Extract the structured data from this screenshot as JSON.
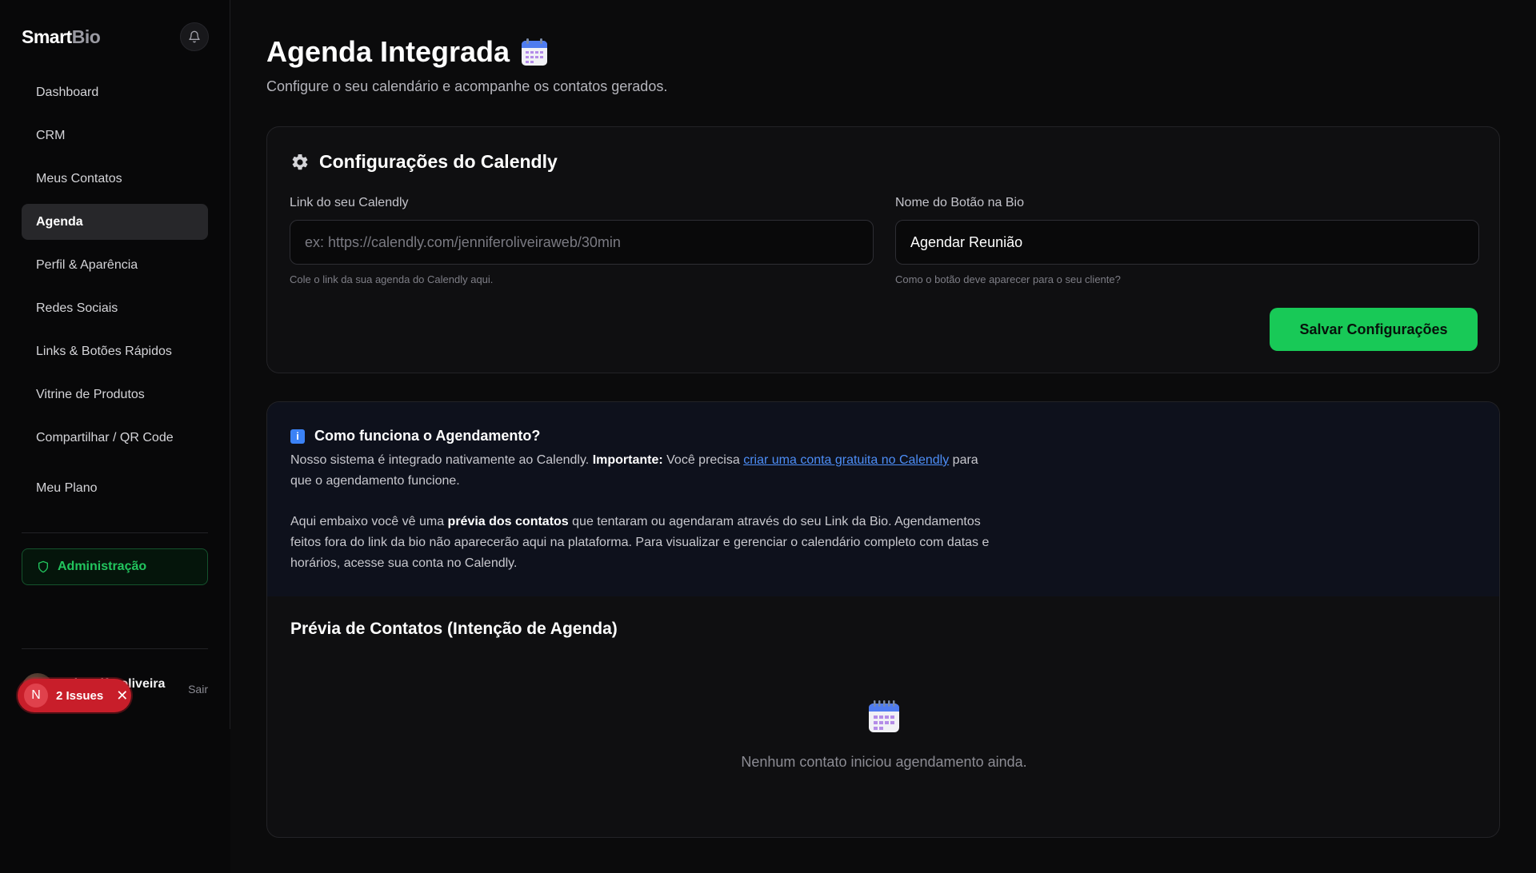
{
  "brand": {
    "name_primary": "Smart",
    "name_secondary": "Bio"
  },
  "sidebar": {
    "items": [
      {
        "label": "Dashboard",
        "active": false
      },
      {
        "label": "CRM",
        "active": false
      },
      {
        "label": "Meus Contatos",
        "active": false
      },
      {
        "label": "Agenda",
        "active": true
      },
      {
        "label": "Perfil & Aparência",
        "active": false
      },
      {
        "label": "Redes Sociais",
        "active": false
      },
      {
        "label": "Links & Botões Rápidos",
        "active": false
      },
      {
        "label": "Vitrine de Produtos",
        "active": false
      },
      {
        "label": "Compartilhar / QR Code",
        "active": false
      },
      {
        "label": "Meu Plano",
        "active": false
      }
    ],
    "admin_label": "Administração",
    "user": {
      "name": "@jenniferoliveira",
      "logout_label": "Sair"
    }
  },
  "issues_badge": {
    "initial": "N",
    "label": "2 Issues"
  },
  "page": {
    "title": "Agenda Integrada",
    "subtitle": "Configure o seu calendário e acompanhe os contatos gerados."
  },
  "config_card": {
    "title": "Configurações do Calendly",
    "link_field": {
      "label": "Link do seu Calendly",
      "value": "",
      "placeholder": "ex: https://calendly.com/jenniferoliveiraweb/30min",
      "help": "Cole o link da sua agenda do Calendly aqui."
    },
    "button_field": {
      "label": "Nome do Botão na Bio",
      "value": "Agendar Reunião",
      "placeholder": "",
      "help": "Como o botão deve aparecer para o seu cliente?"
    },
    "save_label": "Salvar Configurações"
  },
  "info_card": {
    "title": "Como funciona o Agendamento?",
    "p1_a": "Nosso sistema é integrado nativamente ao Calendly. ",
    "p1_bold": "Importante:",
    "p1_b": " Você precisa ",
    "p1_link": "criar uma conta gratuita no Calendly",
    "p1_c": " para que o agendamento funcione.",
    "p2_a": "Aqui embaixo você vê uma ",
    "p2_bold": "prévia dos contatos",
    "p2_b": " que tentaram ou agendaram através do seu Link da Bio. Agendamentos feitos fora do link da bio não aparecerão aqui na plataforma. Para visualizar e gerenciar o calendário completo com datas e horários, acesse sua conta no Calendly.",
    "preview_title": "Prévia de Contatos (Intenção de Agenda)",
    "empty_text": "Nenhum contato iniciou agendamento ainda."
  },
  "colors": {
    "accent": "#18c957",
    "link": "#4d8ef7",
    "admin": "#22c55e",
    "issues": "#c81e2a"
  }
}
